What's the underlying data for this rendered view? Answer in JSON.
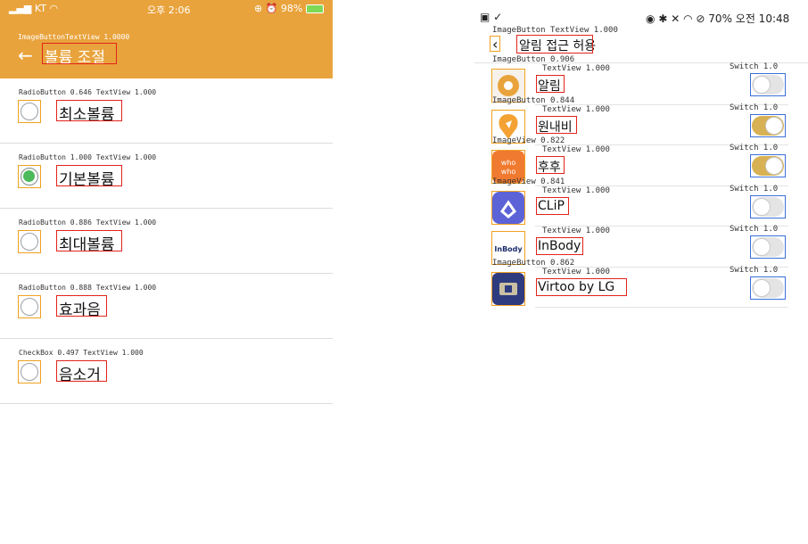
{
  "left": {
    "status": {
      "carrier": "KT",
      "time": "오후 2:06",
      "battery": "98%"
    },
    "header_annotation": "ImageButtonTextView 1.0000",
    "title": "볼륨 조절",
    "back_icon": "arrow-left-icon",
    "rows": [
      {
        "label": "최소볼륨",
        "annotation": "RadioButton 0.646 TextView 1.000",
        "checked": false
      },
      {
        "label": "기본볼륨",
        "annotation": "RadioButton 1.000 TextView 1.000",
        "checked": true
      },
      {
        "label": "최대볼륨",
        "annotation": "RadioButton 0.886 TextView 1.000",
        "checked": false
      },
      {
        "label": "효과음",
        "annotation": "RadioButton 0.888 TextView 1.000",
        "checked": false
      },
      {
        "label": "음소거",
        "annotation": "CheckBox 0.497 TextView 1.000",
        "checked": false
      }
    ],
    "colors": {
      "header": "#e9a33c",
      "radio_checked": "#4cba5a"
    }
  },
  "right": {
    "status": {
      "left_icons": "📷 ✓",
      "right_text": "70% 오전 10:48"
    },
    "top_annotation": "ImageButton TextView 1.000",
    "title": "알림 접근 허용",
    "back_icon": "chevron-left-icon",
    "apps": [
      {
        "name": "알림",
        "icon": "alarm-app-icon",
        "icon_annotation": "ImageButton 0.906",
        "text_annotation": "TextView 1.000",
        "switch_annotation": "Switch 1.0",
        "enabled": false
      },
      {
        "name": "원내비",
        "icon": "onenavi-app-icon",
        "icon_annotation": "ImageButton 0.844",
        "text_annotation": "TextView 1.000",
        "switch_annotation": "Switch 1.0",
        "enabled": true
      },
      {
        "name": "후후",
        "icon": "whowho-app-icon",
        "icon_annotation": "ImageView 0.822",
        "text_annotation": "TextView 1.000",
        "switch_annotation": "Switch 1.0",
        "enabled": true
      },
      {
        "name": "CLiP",
        "icon": "clip-app-icon",
        "icon_annotation": "ImageView 0.841",
        "text_annotation": "TextView 1.000",
        "switch_annotation": "Switch 1.0",
        "enabled": false
      },
      {
        "name": "InBody",
        "icon": "inbody-app-icon",
        "icon_annotation": "",
        "text_annotation": "TextView 1.000",
        "switch_annotation": "Switch 1.0",
        "enabled": false
      },
      {
        "name": "Virtoo by LG",
        "icon": "virtoo-app-icon",
        "icon_annotation": "ImageButton 0.862",
        "text_annotation": "TextView 1.000",
        "switch_annotation": "Switch 1.0",
        "enabled": false
      }
    ],
    "inbody_logo_text": "InBody",
    "colors": {
      "switch_on": "#d7b153",
      "switch_off": "#e4e4e4"
    }
  }
}
